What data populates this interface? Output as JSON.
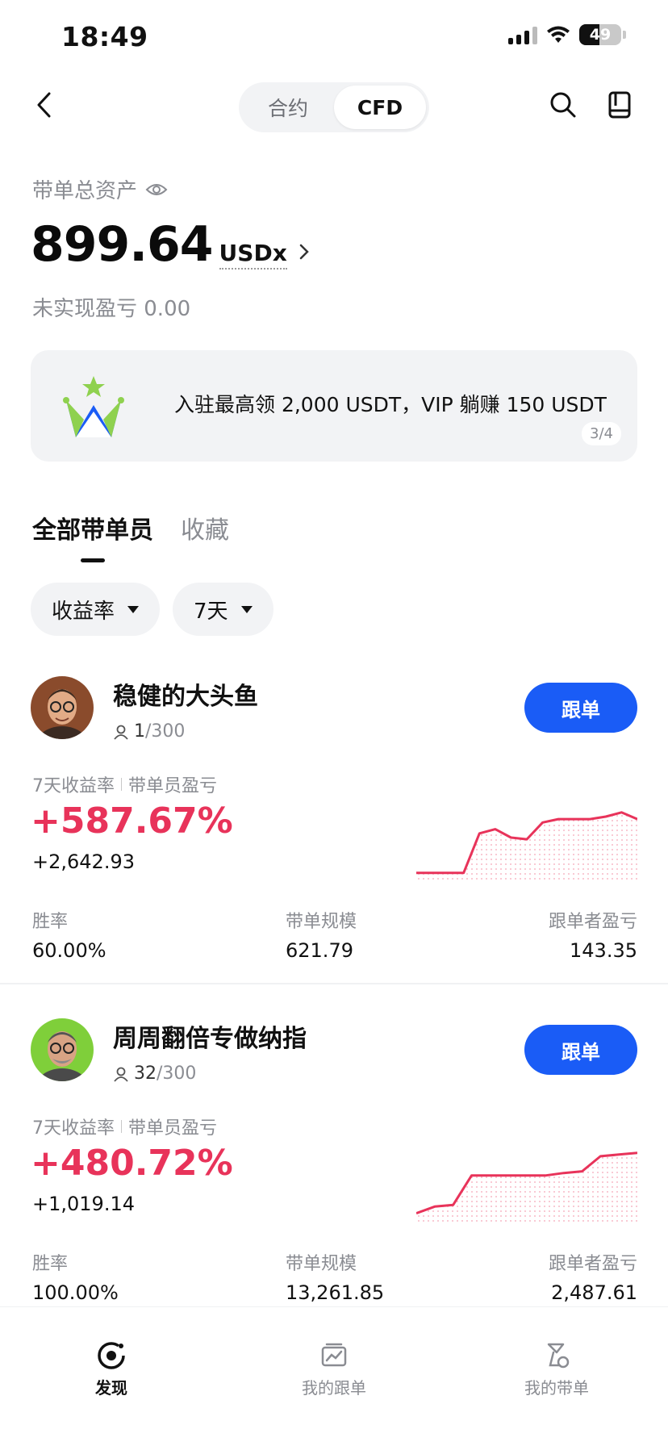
{
  "status": {
    "time": "18:49",
    "battery": "49",
    "battery_level": 0.49
  },
  "nav": {
    "tabs": [
      {
        "label": "合约",
        "active": false
      },
      {
        "label": "CFD",
        "active": true
      }
    ]
  },
  "assets": {
    "label": "带单总资产",
    "value": "899.64",
    "unit": "USDx",
    "unrealized_pnl": "未实现盈亏 0.00"
  },
  "banner": {
    "text": "入驻最高领 2,000 USDT，VIP 躺赚 150 USDT",
    "page": "3/4"
  },
  "tabs": [
    {
      "label": "全部带单员",
      "active": true
    },
    {
      "label": "收藏",
      "active": false
    }
  ],
  "filters": [
    {
      "label": "收益率"
    },
    {
      "label": "7天"
    }
  ],
  "traders": [
    {
      "name": "稳健的大头鱼",
      "followers": "1",
      "followers_max": "/300",
      "follow_label": "跟单",
      "metric_label_1": "7天收益率",
      "metric_label_2": "带单员盈亏",
      "roi": "+587.67%",
      "pnl": "+2,642.93",
      "stats": [
        {
          "label": "胜率",
          "value": "60.00%"
        },
        {
          "label": "带单规模",
          "value": "621.79"
        },
        {
          "label": "跟单者盈亏",
          "value": "143.35"
        }
      ],
      "sparkline": [
        0.08,
        0.08,
        0.08,
        0.08,
        0.55,
        0.6,
        0.5,
        0.48,
        0.68,
        0.72,
        0.72,
        0.72,
        0.75,
        0.8,
        0.72
      ],
      "avatar_bg": "#8a4b2c"
    },
    {
      "name": "周周翻倍专做纳指",
      "followers": "32",
      "followers_max": "/300",
      "follow_label": "跟单",
      "metric_label_1": "7天收益率",
      "metric_label_2": "带单员盈亏",
      "roi": "+480.72%",
      "pnl": "+1,019.14",
      "stats": [
        {
          "label": "胜率",
          "value": "100.00%"
        },
        {
          "label": "带单规模",
          "value": "13,261.85"
        },
        {
          "label": "跟单者盈亏",
          "value": "2,487.61"
        }
      ],
      "sparkline": [
        0.1,
        0.18,
        0.2,
        0.55,
        0.55,
        0.55,
        0.55,
        0.55,
        0.58,
        0.6,
        0.78,
        0.8,
        0.82
      ],
      "avatar_bg": "#7fcf3a"
    }
  ],
  "bottom_nav": [
    {
      "label": "发现",
      "icon": "discover-icon",
      "active": true
    },
    {
      "label": "我的跟单",
      "icon": "copy-chart-icon",
      "active": false
    },
    {
      "label": "我的带单",
      "icon": "lead-trade-icon",
      "active": false
    }
  ],
  "colors": {
    "accent": "#1a5cf6",
    "positive": "#e8335a",
    "muted": "#8a8c92"
  }
}
